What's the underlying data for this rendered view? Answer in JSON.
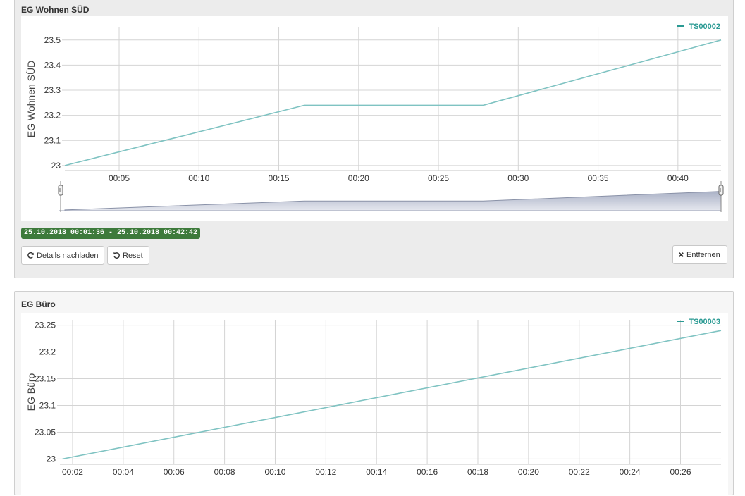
{
  "panels": [
    {
      "title": "EG Wohnen SÜD",
      "date_range": "25.10.2018 00:01:36 - 25.10.2018 00:42:42",
      "buttons": {
        "reload": "Details nachladen",
        "reset": "Reset",
        "remove": "Entfernen"
      }
    },
    {
      "title": "EG Büro"
    }
  ],
  "colors": {
    "series": "#7fc3c2",
    "legend": "#2a9a93",
    "grid": "#d4d4d4",
    "navigator_fill": "#b3b9cb",
    "navigator_stroke": "#8a92a8",
    "badge": "#3d7a3b"
  },
  "icons": {
    "reload": "refresh-icon",
    "reset": "undo-icon",
    "remove": "close-icon"
  },
  "chart_data": [
    {
      "type": "line",
      "ylabel": "EG Wohnen SÜD",
      "xlabel": "",
      "x_tick_labels": [
        "00:05",
        "00:10",
        "00:15",
        "00:20",
        "00:25",
        "00:30",
        "00:35",
        "00:40"
      ],
      "x_ticks_min": [
        5,
        10,
        15,
        20,
        25,
        30,
        35,
        40
      ],
      "y_ticks": [
        23,
        23.1,
        23.2,
        23.3,
        23.4,
        23.5
      ],
      "y_tick_labels": [
        "23",
        "23.1",
        "23.2",
        "23.3",
        "23.4",
        "23.5"
      ],
      "xlim_min": [
        1.6,
        42.7
      ],
      "ylim": [
        22.98,
        23.55
      ],
      "grid": true,
      "legend_position": "top-right",
      "navigator": true,
      "series": [
        {
          "name": "TS00002",
          "x_min": [
            1.6,
            16.6,
            27.8,
            42.7
          ],
          "y": [
            23.0,
            23.24,
            23.24,
            23.5
          ]
        }
      ]
    },
    {
      "type": "line",
      "ylabel": "EG Büro",
      "xlabel": "",
      "x_tick_labels": [
        "00:02",
        "00:04",
        "00:06",
        "00:08",
        "00:10",
        "00:12",
        "00:14",
        "00:16",
        "00:18",
        "00:20",
        "00:22",
        "00:24",
        "00:26"
      ],
      "x_ticks_min": [
        2,
        4,
        6,
        8,
        10,
        12,
        14,
        16,
        18,
        20,
        22,
        24,
        26
      ],
      "y_ticks": [
        23,
        23.05,
        23.1,
        23.15,
        23.2,
        23.25
      ],
      "y_tick_labels": [
        "23",
        "23.05",
        "23.1",
        "23.15",
        "23.2",
        "23.25"
      ],
      "xlim_min": [
        1.5,
        27.6
      ],
      "ylim": [
        22.99,
        23.26
      ],
      "grid": true,
      "legend_position": "top-right",
      "navigator": false,
      "series": [
        {
          "name": "TS00003",
          "x_min": [
            1.6,
            27.6
          ],
          "y": [
            23.0,
            23.24
          ]
        }
      ]
    }
  ]
}
